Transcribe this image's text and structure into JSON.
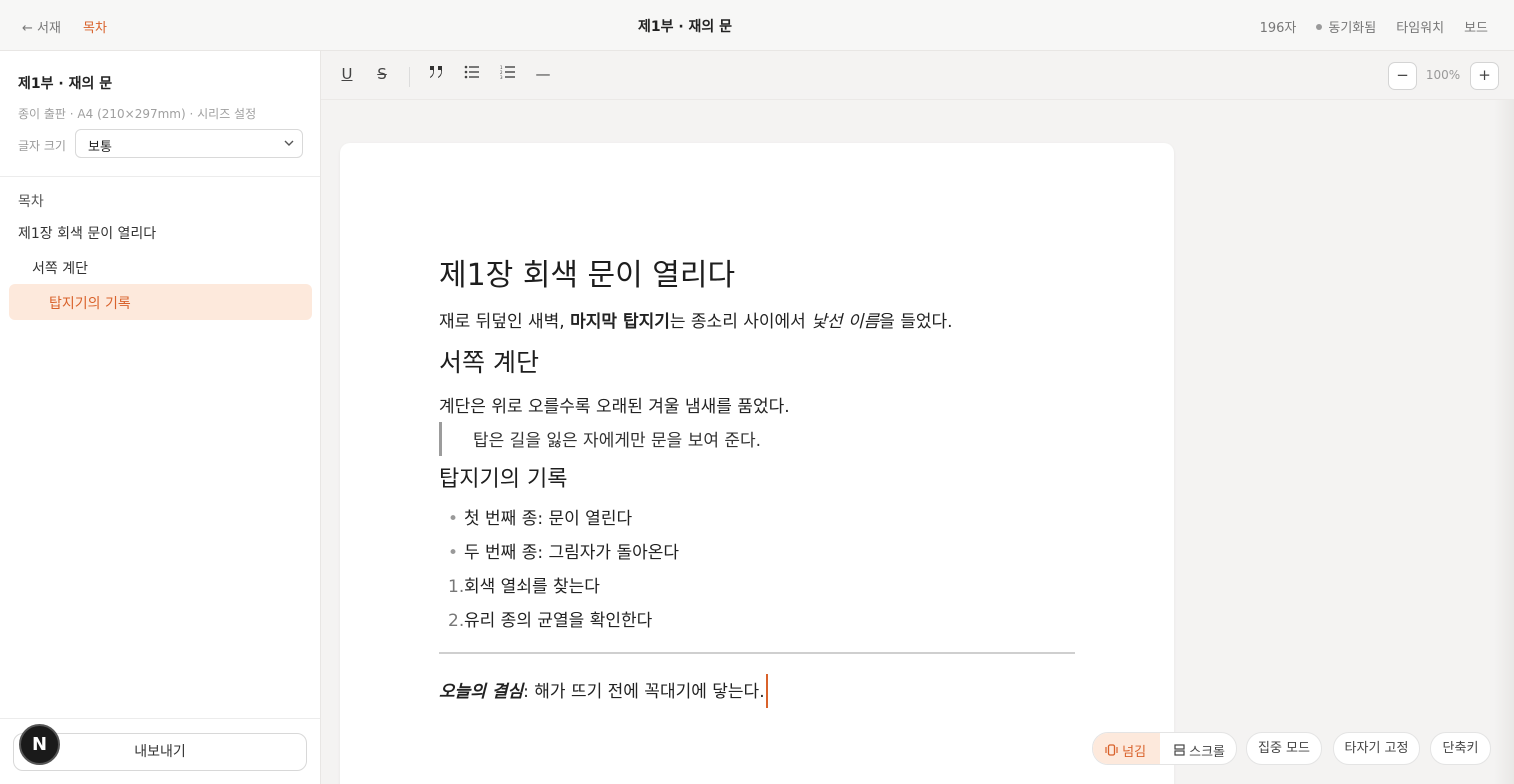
{
  "topbar": {
    "back_label": "← 서재",
    "toc_label": "목차",
    "doc_title": "제1부 · 재의 문",
    "char_count": "196자",
    "sync_status": "동기화됨",
    "timer": "타임워치",
    "board": "보드"
  },
  "sidebar": {
    "title": "제1부 · 재의 문",
    "meta": "종이 출판 · A4 (210×297mm) · 시리즈 설정",
    "font_size_label": "글자 크기",
    "font_size_value": "보통",
    "toc_heading": "목차",
    "toc_items": [
      {
        "label": "제1장 회색 문이 열리다",
        "level": 1
      },
      {
        "label": "서쪽 계단",
        "level": 2
      },
      {
        "label": "탑지기의 기록",
        "level": 3,
        "active": true
      }
    ],
    "export_label": "내보내기",
    "avatar_letter": "N"
  },
  "toolbar": {
    "underline": "U",
    "strike": "S",
    "quote": "❞",
    "bullet_list": "☰",
    "numbered_list": "☷",
    "rule": "—",
    "zoom_out": "−",
    "zoom_value": "100%",
    "zoom_in": "+"
  },
  "document": {
    "h1": "제1장 회색 문이 열리다",
    "p1_a": "재로 뒤덮인 새벽, ",
    "p1_bold": "마지막 탑지기",
    "p1_b": "는 종소리 사이에서 ",
    "p1_italic": "낯선 이름",
    "p1_c": "을 들었다.",
    "h2a": "서쪽 계단",
    "p2": "계단은 위로 오를수록 오래된 겨울 냄새를 품었다.",
    "quote": "탑은 길을 잃은 자에게만 문을 보여 준다.",
    "h2b": "탑지기의 기록",
    "bullets": [
      "첫 번째 종: 문이 열린다",
      "두 번째 종: 그림자가 돌아온다"
    ],
    "numbered": [
      {
        "num": "1.",
        "text": "회색 열쇠를 찾는다"
      },
      {
        "num": "2.",
        "text": "유리 종의 균열을 확인한다"
      }
    ],
    "p3_em": "오늘의 결심",
    "p3_rest": ": 해가 뜨기 전에 꼭대기에 닿는다."
  },
  "bottom": {
    "flip": "넘김",
    "scroll": "스크롤",
    "focus": "집중 모드",
    "typewriter": "타자기 고정",
    "shortcuts": "단축키"
  },
  "colors": {
    "accent": "#d9622b",
    "accent_bg": "#fde9dc"
  }
}
